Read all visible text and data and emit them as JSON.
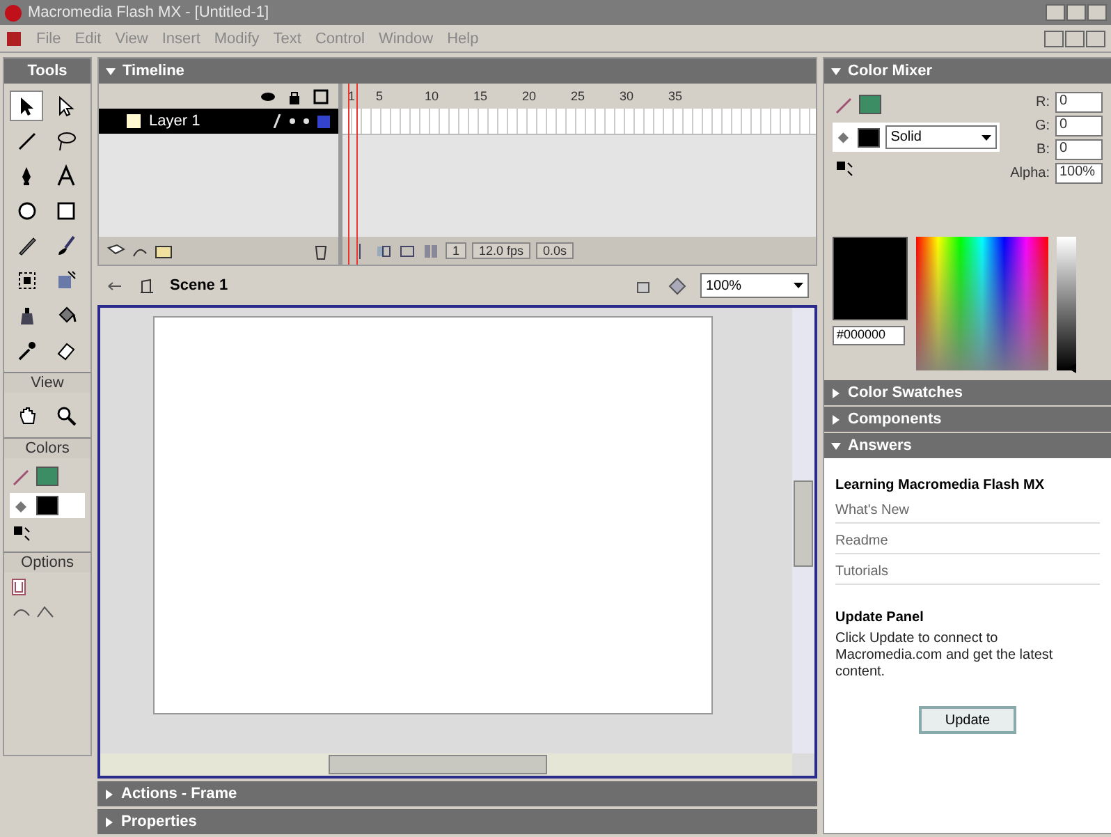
{
  "window": {
    "title": "Macromedia Flash MX - [Untitled-1]"
  },
  "menu": [
    "File",
    "Edit",
    "View",
    "Insert",
    "Modify",
    "Text",
    "Control",
    "Window",
    "Help"
  ],
  "tools": {
    "title": "Tools",
    "items": [
      {
        "selected": true
      },
      {
        "selected": false
      },
      {
        "selected": false
      },
      {
        "selected": false
      },
      {
        "selected": false
      },
      {
        "selected": false
      },
      {
        "selected": false
      },
      {
        "selected": false
      },
      {
        "selected": false
      },
      {
        "selected": false
      },
      {
        "selected": false
      },
      {
        "selected": false
      },
      {
        "selected": false
      },
      {
        "selected": false
      },
      {
        "selected": false
      },
      {
        "selected": false
      }
    ],
    "view_title": "View",
    "view_items": [
      {
        "selected": false
      },
      {
        "selected": false
      }
    ],
    "colors_title": "Colors",
    "stroke": {
      "color": "#3c8c64",
      "selected": false
    },
    "fill": {
      "color": "#000000",
      "selected": true
    },
    "options_title": "Options"
  },
  "timeline": {
    "title": "Timeline",
    "frame_numbers": [
      "1",
      "5",
      "10",
      "15",
      "20",
      "25",
      "30",
      "35"
    ],
    "layers": [
      {
        "name": "Layer 1",
        "selected": true
      }
    ],
    "current_frame": "1",
    "frame_rate": "12.0 fps",
    "elapsed": "0.0s"
  },
  "scene": {
    "name": "Scene 1",
    "zoom": "100%"
  },
  "color_mixer": {
    "title": "Color Mixer",
    "stroke": {
      "color": "#3c8c64",
      "selected": false
    },
    "fill": {
      "color": "#000000",
      "selected": true
    },
    "fill_style": "Solid",
    "channels": [
      {
        "label": "R:",
        "value": "0"
      },
      {
        "label": "G:",
        "value": "0"
      },
      {
        "label": "B:",
        "value": "0"
      }
    ],
    "alpha": {
      "label": "Alpha:",
      "value": "100%"
    },
    "hex": "#000000",
    "brightness": {
      "level": 0.02
    }
  },
  "panels": [
    {
      "title": "Color Swatches",
      "expanded": false
    },
    {
      "title": "Components",
      "expanded": false
    },
    {
      "title": "Answers",
      "expanded": true
    }
  ],
  "answers": {
    "heading": "Learning Macromedia Flash MX",
    "links": [
      "What's New",
      "Readme",
      "Tutorials"
    ],
    "update_heading": "Update Panel",
    "update_text": "Click Update to connect to Macromedia.com and get the latest content.",
    "button": "Update"
  },
  "bottom_panels": [
    {
      "title": "Actions - Frame",
      "expanded": false
    },
    {
      "title": "Properties",
      "expanded": false
    }
  ]
}
